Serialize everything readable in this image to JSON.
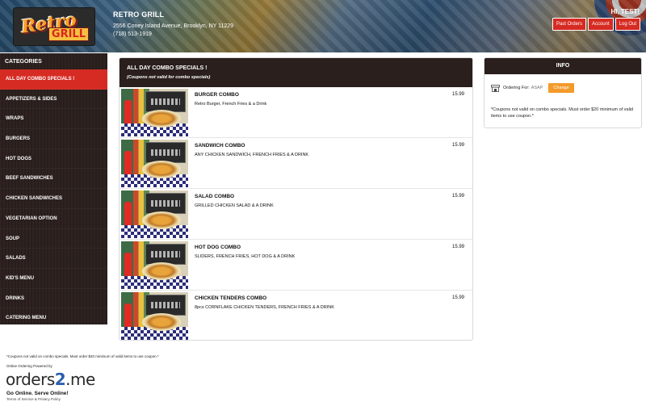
{
  "header": {
    "logo": {
      "line1": "Retro",
      "line2": "GRILL"
    },
    "restaurant_name": "RETRO GRILL",
    "address": "2556 Coney Island Avenue, Brooklyn, NY 11229",
    "phone": "(718) 513-1919",
    "greeting": "HI, TEST!",
    "buttons": [
      "Past Orders",
      "Account",
      "Log Out"
    ]
  },
  "sidebar": {
    "title": "CATEGORIES",
    "items": [
      {
        "label": "ALL DAY COMBO SPECIALS !",
        "active": true
      },
      {
        "label": "APPETIZERS & SIDES"
      },
      {
        "label": "WRAPS"
      },
      {
        "label": "BURGERS"
      },
      {
        "label": "HOT DOGS"
      },
      {
        "label": "BEEF SANDWICHES"
      },
      {
        "label": "CHICKEN SANDWICHES"
      },
      {
        "label": "VEGETARIAN OPTION"
      },
      {
        "label": "SOUP"
      },
      {
        "label": "SALADS"
      },
      {
        "label": "KID'S MENU"
      },
      {
        "label": "DRINKS"
      },
      {
        "label": "CATERING MENU"
      }
    ]
  },
  "menu": {
    "title": "ALL DAY COMBO SPECIALS !",
    "subtitle": "(Coupons not valid for combo specials)",
    "items": [
      {
        "name": "BURGER COMBO",
        "desc": "Retro Burger, French Fries & a Drink",
        "price": "15.99"
      },
      {
        "name": "SANDWICH COMBO",
        "desc": "ANY CHICKEN SANDWICH, FRENCH FRIES & A DRINK",
        "price": "15.99"
      },
      {
        "name": "SALAD COMBO",
        "desc": "GRILLED CHICKEN SALAD & A DRINK",
        "price": "15.99"
      },
      {
        "name": "HOT DOG COMBO",
        "desc": "SLIDERS, FRENCH FRIES, HOT DOG & A DRINK",
        "price": "15.99"
      },
      {
        "name": "CHICKEN TENDERS COMBO",
        "desc": "8pcs CORNFLAKE CHICKEN TENDERS, FRENCH FRIES & A DRINK",
        "price": "15.99"
      }
    ]
  },
  "info": {
    "title": "INFO",
    "ordering_for_label": "Ordering For:",
    "ordering_for_value": "ASAP",
    "change_label": "Change",
    "coupon_note": "*Coupons not valid on combo specials. Must order $20 minimum of valid items to use coupon.*"
  },
  "footer": {
    "note": "*Coupons not valid on combo specials. Must order $20 minimum of valid items to use coupon.*",
    "powered_by": "Online Ordering Powered by",
    "brand_part1": "orders",
    "brand_part2": "2",
    "brand_part3": ".me",
    "slogan": "Go Online. Serve Online!",
    "terms": "Terms of Service & Privacy Policy"
  }
}
